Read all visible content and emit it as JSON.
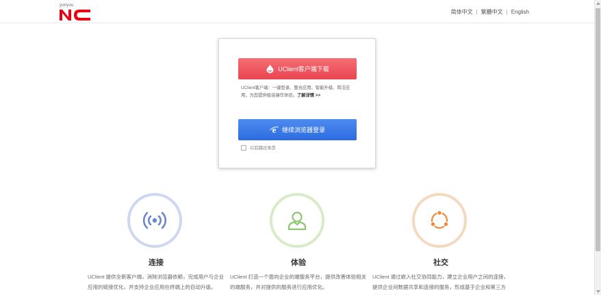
{
  "header": {
    "logo_top": "yonyou",
    "logo_text": "NC",
    "languages": [
      "简体中文",
      "繁體中文",
      "English"
    ],
    "separator": "|"
  },
  "card": {
    "download_button": "UClient客户端下载",
    "description": "UClient客户端：一键登录、整合应用、智能升级、简洁应用，为您提供极佳操作体验。",
    "more_link": "了解详情 >>",
    "browser_login_button": "继续浏览器登录",
    "skip_label": "以后跳过本页"
  },
  "features": [
    {
      "title": "连接",
      "desc": "UClient 提供全新客户端，消除浏览器依赖，完成用户与企业应用的链接优化，并支持企业应用在终端上的自动升级。",
      "icon": "wifi-signal-icon",
      "color": "#6b86c9"
    },
    {
      "title": "体验",
      "desc": "UClient 打造一个面向企业的端服务平台，提供改善体验相关的端服务，并对提供的服务进行应用优化。",
      "icon": "user-icon",
      "color": "#8cc56e"
    },
    {
      "title": "社交",
      "desc": "UClient 通过嵌入社交协同能力，建立企业用户之间的连接，提供企业间数据共享和连接的服务，形成基于企业和第三方的企业社交网络。",
      "icon": "social-cycle-icon",
      "color": "#ef8a3a"
    }
  ],
  "colors": {
    "red": "#ea4550",
    "blue": "#2c6be0",
    "brand": "#e60012"
  }
}
